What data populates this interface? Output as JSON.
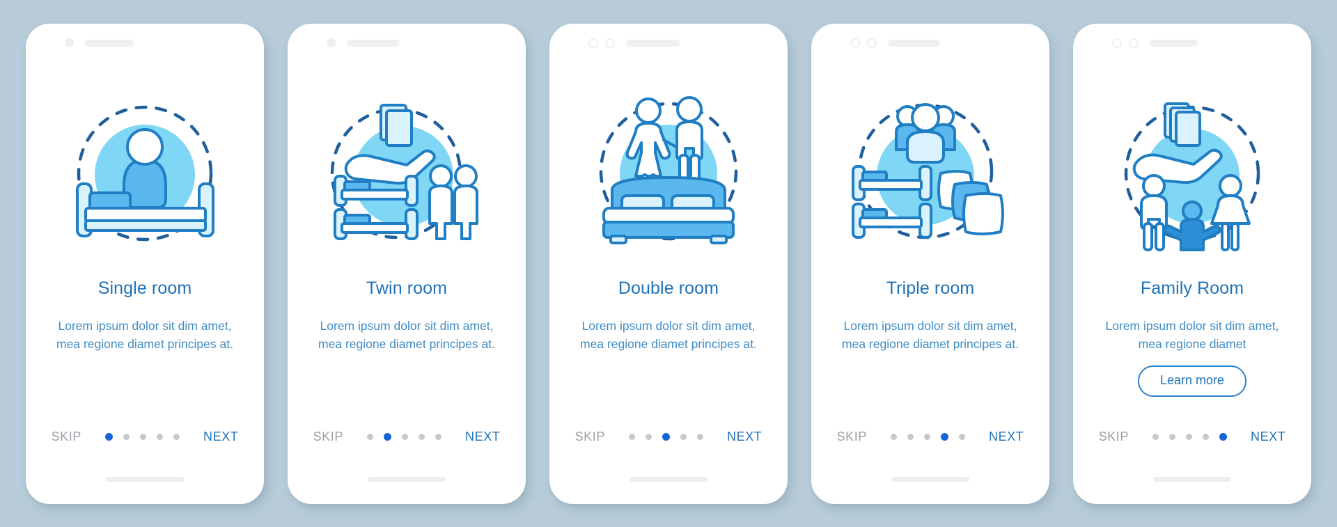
{
  "theme": {
    "background": "#b7ccd8",
    "card_background": "#ffffff",
    "title_color": "#2072b8",
    "body_color": "#3f8cc4",
    "accent_blue": "#1565d8",
    "skip_color": "#9aa0a6",
    "illustration_circle": "#7fd6f5",
    "illustration_stroke": "#1f7ec4",
    "illustration_fill_light": "#d9f2fc",
    "illustration_fill_mid": "#5bb8ef"
  },
  "screens": [
    {
      "id": "single-room",
      "title": "Single room",
      "body": "Lorem ipsum dolor sit dim amet, mea regione diamet principes at.",
      "illustration": "single-bed-person",
      "skip_label": "SKIP",
      "next_label": "NEXT",
      "dots_total": 5,
      "active_dot": 1,
      "has_learn_more": false,
      "learn_more_label": ""
    },
    {
      "id": "twin-room",
      "title": "Twin room",
      "body": "Lorem ipsum dolor sit dim amet, mea regione diamet principes at.",
      "illustration": "twin-beds-hand-cards",
      "skip_label": "SKIP",
      "next_label": "NEXT",
      "dots_total": 5,
      "active_dot": 2,
      "has_learn_more": false,
      "learn_more_label": ""
    },
    {
      "id": "double-room",
      "title": "Double room",
      "body": "Lorem ipsum dolor sit dim amet, mea regione diamet principes at.",
      "illustration": "double-bed-couple",
      "skip_label": "SKIP",
      "next_label": "NEXT",
      "dots_total": 5,
      "active_dot": 3,
      "has_learn_more": false,
      "learn_more_label": ""
    },
    {
      "id": "triple-room",
      "title": "Triple room",
      "body": "Lorem ipsum dolor sit dim amet, mea regione diamet principes at.",
      "illustration": "bunk-beds-pillows-group",
      "skip_label": "SKIP",
      "next_label": "NEXT",
      "dots_total": 5,
      "active_dot": 4,
      "has_learn_more": false,
      "learn_more_label": ""
    },
    {
      "id": "family-room",
      "title": "Family Room",
      "body": "Lorem ipsum dolor sit dim amet, mea regione diamet",
      "illustration": "family-hand-cards",
      "skip_label": "SKIP",
      "next_label": "NEXT",
      "dots_total": 5,
      "active_dot": 5,
      "has_learn_more": true,
      "learn_more_label": "Learn more"
    }
  ]
}
